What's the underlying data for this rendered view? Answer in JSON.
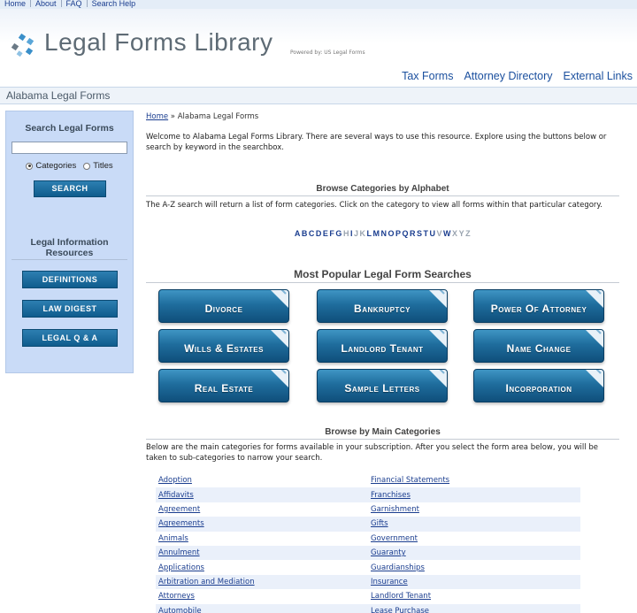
{
  "topnav": [
    "Home",
    "About",
    "FAQ",
    "Search Help"
  ],
  "brand": {
    "title": "Legal Forms Library",
    "powered": "Powered by: US Legal Forms"
  },
  "header_links": [
    "Tax Forms",
    "Attorney Directory",
    "External Links"
  ],
  "section_title": "Alabama Legal Forms",
  "sidebar": {
    "search_title": "Search Legal Forms",
    "search_value": "",
    "radio_categories": "Categories",
    "radio_titles": "Titles",
    "selected_radio": "Categories",
    "search_button": "SEARCH",
    "resources_title": "Legal Information Resources",
    "buttons": [
      "DEFINITIONS",
      "LAW DIGEST",
      "LEGAL Q & A"
    ]
  },
  "breadcrumb": {
    "home": "Home",
    "separator": " » ",
    "current": "Alabama Legal Forms"
  },
  "intro": "Welcome to Alabama Legal Forms Library. There are several ways to use this resource. Explore using the buttons below or search by keyword in the searchbox.",
  "alphabet": {
    "heading": "Browse Categories by Alphabet",
    "description": "The A-Z search will return a list of form categories. Click on the category to view all forms within that particular category.",
    "letters": [
      {
        "l": "A",
        "on": true
      },
      {
        "l": "B",
        "on": true
      },
      {
        "l": "C",
        "on": true
      },
      {
        "l": "D",
        "on": true
      },
      {
        "l": "E",
        "on": true
      },
      {
        "l": "F",
        "on": true
      },
      {
        "l": "G",
        "on": true
      },
      {
        "l": "H",
        "on": false
      },
      {
        "l": "I",
        "on": true
      },
      {
        "l": "J",
        "on": false
      },
      {
        "l": "K",
        "on": false
      },
      {
        "l": "L",
        "on": true
      },
      {
        "l": "M",
        "on": true
      },
      {
        "l": "N",
        "on": true
      },
      {
        "l": "O",
        "on": true
      },
      {
        "l": "P",
        "on": true
      },
      {
        "l": "Q",
        "on": true
      },
      {
        "l": "R",
        "on": true
      },
      {
        "l": "S",
        "on": true
      },
      {
        "l": "T",
        "on": true
      },
      {
        "l": "U",
        "on": true
      },
      {
        "l": "V",
        "on": false
      },
      {
        "l": "W",
        "on": true
      },
      {
        "l": "X",
        "on": false
      },
      {
        "l": "Y",
        "on": false
      },
      {
        "l": "Z",
        "on": false
      }
    ]
  },
  "popular": {
    "heading": "Most Popular Legal Form Searches",
    "buttons": [
      "Divorce",
      "Bankruptcy",
      "Power Of Attorney",
      "Wills & Estates",
      "Landlord Tenant",
      "Name Change",
      "Real Estate",
      "Sample Letters",
      "Incorporation"
    ]
  },
  "main_categories": {
    "heading": "Browse by Main Categories",
    "description": "Below are the main categories for forms available in your subscription. After you select the form area below, you will be taken to sub-categories to narrow your search.",
    "rows": [
      [
        "Adoption",
        "Financial Statements"
      ],
      [
        "Affidavits",
        "Franchises"
      ],
      [
        "Agreement",
        "Garnishment"
      ],
      [
        "Agreements",
        "Gifts"
      ],
      [
        "Animals",
        "Government"
      ],
      [
        "Annulment",
        "Guaranty"
      ],
      [
        "Applications",
        "Guardianships"
      ],
      [
        "Arbitration and Mediation",
        "Insurance"
      ],
      [
        "Attorneys",
        "Landlord Tenant"
      ],
      [
        "Automobile",
        "Lease Purchase"
      ]
    ]
  },
  "colors": {
    "accent": "#1a4f9e",
    "sidebar_bg": "#c9dbf7",
    "button_blue": "#1f6d9d"
  }
}
